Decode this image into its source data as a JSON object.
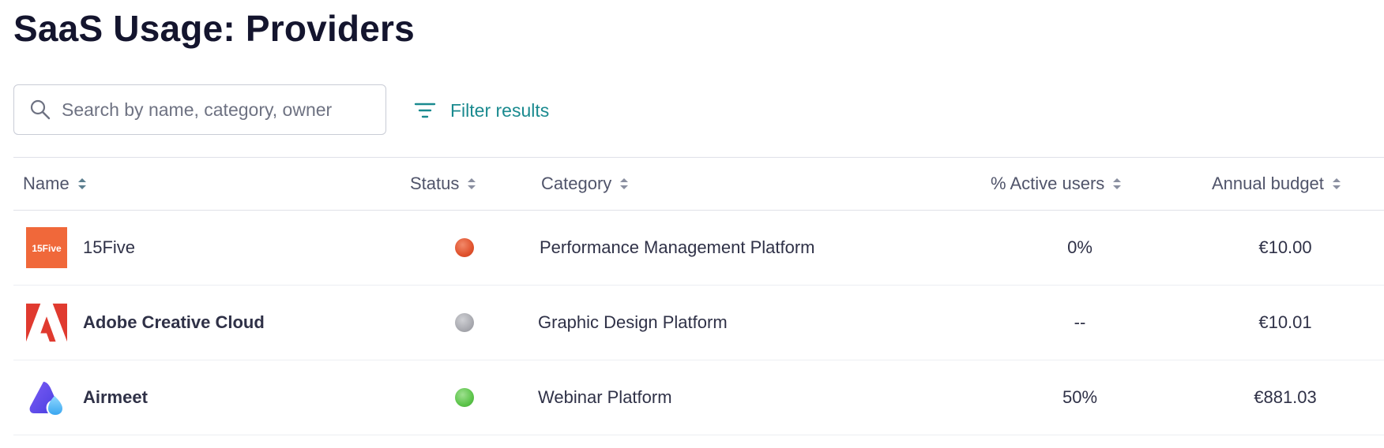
{
  "page": {
    "title": "SaaS Usage: Providers"
  },
  "search": {
    "placeholder": "Search by name, category, owner",
    "icon": "search-icon"
  },
  "filter": {
    "label": "Filter results",
    "icon": "filter-lines-icon",
    "color": "#1a8a8f"
  },
  "table": {
    "columns": [
      {
        "label": "Name",
        "sortable": true
      },
      {
        "label": "Status",
        "sortable": true
      },
      {
        "label": "Category",
        "sortable": true
      },
      {
        "label": "% Active users",
        "sortable": true
      },
      {
        "label": "Annual budget",
        "sortable": true
      }
    ],
    "rows": [
      {
        "name": "15Five",
        "logo_text": "15Five",
        "logo_color": "#f0683a",
        "status_color": "#e0522d",
        "category": "Performance Management Platform",
        "active_users": "0%",
        "annual_budget": "€10.00"
      },
      {
        "name": "Adobe Creative Cloud",
        "logo_color": "#e03a2f",
        "status_color": "#a9aab0",
        "category": "Graphic Design Platform",
        "active_users": "--",
        "annual_budget": "€10.01"
      },
      {
        "name": "Airmeet",
        "logo_color": "#5b55f0",
        "status_color": "#5cc44a",
        "category": "Webinar Platform",
        "active_users": "50%",
        "annual_budget": "€881.03"
      }
    ]
  }
}
